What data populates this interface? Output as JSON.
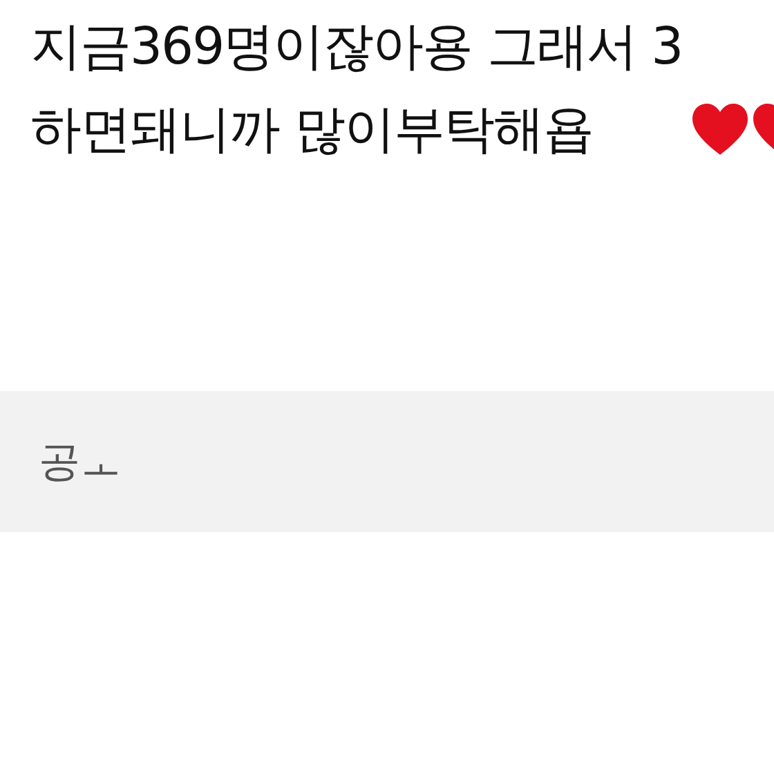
{
  "post": {
    "lines": [
      "지금369명이잖아용 그래서 3",
      "하면돼니까 많이부탁해욥"
    ]
  },
  "reply_box": {
    "text": "공ㅗ"
  }
}
